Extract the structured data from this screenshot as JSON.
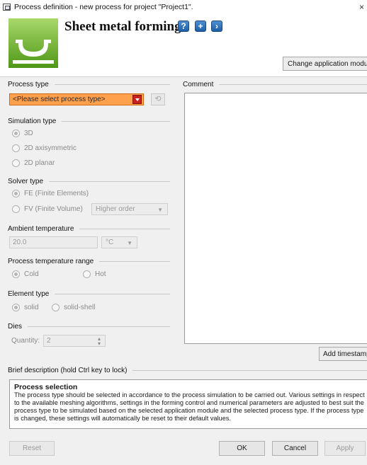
{
  "window": {
    "title": "Process definition - new process for project \"Project1\".",
    "close_glyph": "×"
  },
  "header": {
    "module_title": "Sheet metal forming",
    "icons": [
      "help-icon",
      "add-icon",
      "next-icon"
    ],
    "change_module_label": "Change application module"
  },
  "process_type": {
    "label": "Process type",
    "selected": "<Please select process type>",
    "accent_color": "#ffa04d"
  },
  "comment": {
    "label": "Comment",
    "value": ""
  },
  "simulation_type": {
    "label": "Simulation type",
    "options": [
      "3D",
      "2D axisymmetric",
      "2D planar"
    ],
    "selected_index": 0
  },
  "solver_type": {
    "label": "Solver type",
    "options": [
      "FE (Finite Elements)",
      "FV (Finite Volume)"
    ],
    "selected_index": 0,
    "fv_order": "Higher order"
  },
  "ambient_temperature": {
    "label": "Ambient temperature",
    "value": "20.0",
    "unit": "°C"
  },
  "process_temperature_range": {
    "label": "Process temperature range",
    "options": [
      "Cold",
      "Hot"
    ],
    "selected_index": 0
  },
  "element_type": {
    "label": "Element type",
    "options": [
      "solid",
      "solid-shell"
    ],
    "selected_index": 0
  },
  "dies": {
    "label": "Dies",
    "quantity_label": "Quantity:",
    "quantity": "2"
  },
  "add_timestamp_label": "Add timestamp",
  "brief_description": {
    "label": "Brief description (hold Ctrl key to lock)",
    "title": "Process selection",
    "text": "The process type should be selected in accordance to the process simulation to be carried out. Various settings in respect to the available meshing algorithms, settings in the forming control and numerical parameters are adjusted to best suit the process type to be simulated based on the selected application module and the selected process type. If the process type is changed, these settings will automatically be reset to their default values."
  },
  "footer": {
    "reset": "Reset",
    "ok": "OK",
    "cancel": "Cancel",
    "apply": "Apply"
  }
}
